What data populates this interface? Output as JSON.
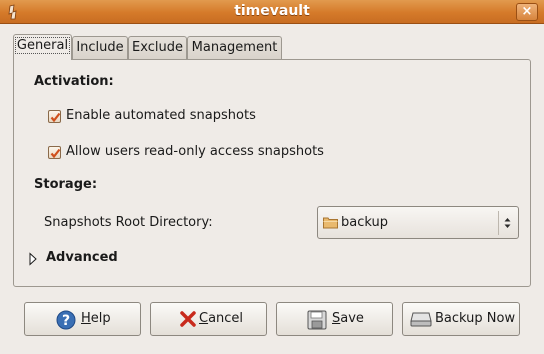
{
  "window": {
    "title": "timevault",
    "icon": "timevault-app-icon",
    "close_label": "×"
  },
  "tabs": [
    {
      "label": "General",
      "active": true
    },
    {
      "label": "Include",
      "active": false
    },
    {
      "label": "Exclude",
      "active": false
    },
    {
      "label": "Management",
      "active": false
    }
  ],
  "activation": {
    "heading": "Activation:",
    "enable_snapshots": {
      "label": "Enable automated snapshots",
      "checked": true
    },
    "read_only_access": {
      "label": "Allow users read-only access snapshots",
      "checked": true
    }
  },
  "storage": {
    "heading": "Storage:",
    "root_dir_label": "Snapshots Root Directory:",
    "root_dir_value": "backup"
  },
  "advanced": {
    "label": "Advanced",
    "expanded": false
  },
  "buttons": {
    "help": {
      "first": "H",
      "rest": "elp"
    },
    "cancel": {
      "first": "C",
      "rest": "ancel"
    },
    "save": {
      "first": "S",
      "rest": "ave"
    },
    "backup_now": "Backup Now"
  },
  "colors": {
    "titlebar": "#d57a2a",
    "check_mark": "#d0501c",
    "window_bg": "#efebe7"
  }
}
